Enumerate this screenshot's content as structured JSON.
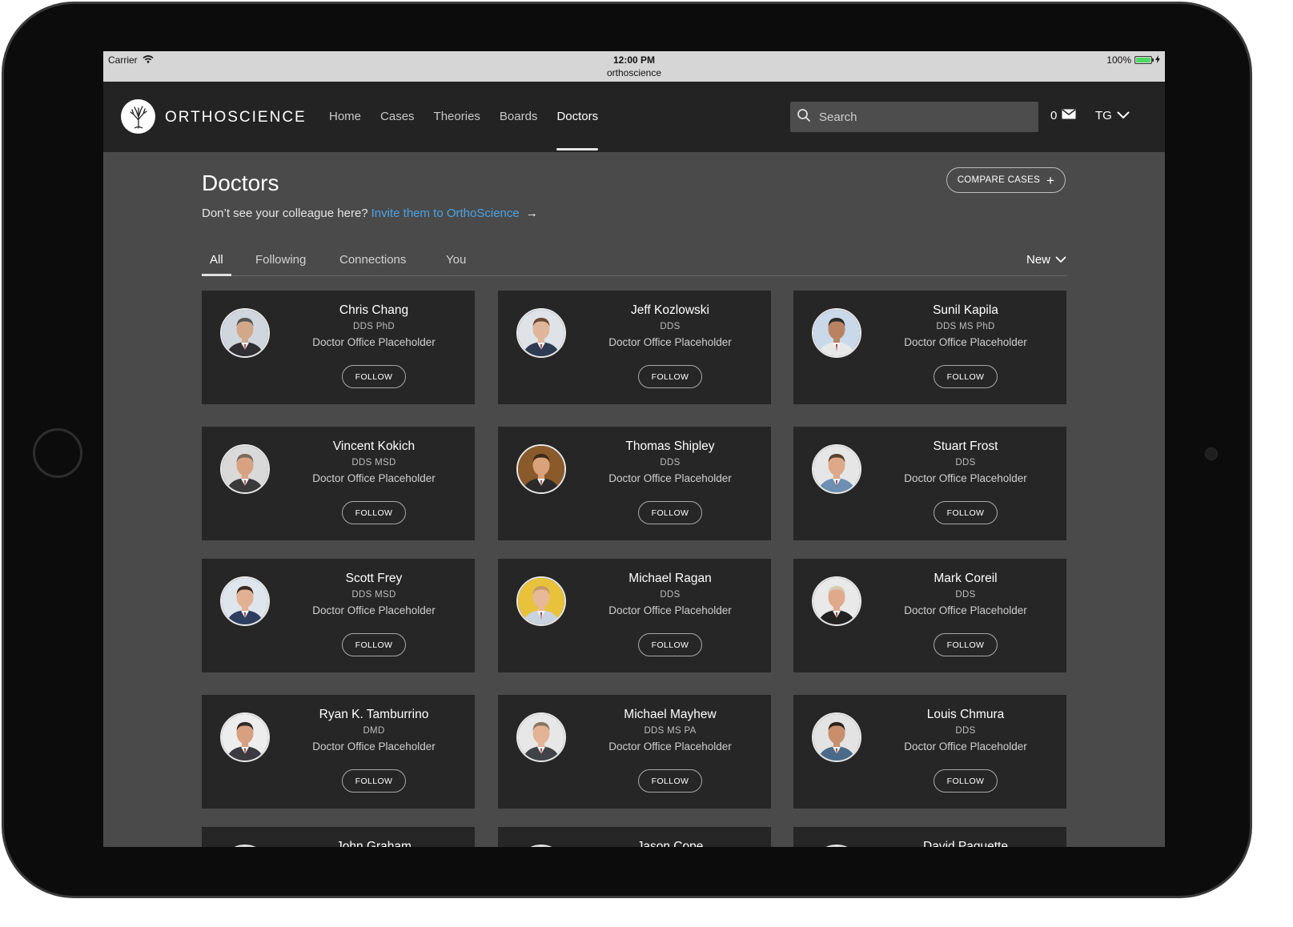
{
  "statusbar": {
    "carrier": "Carrier",
    "time": "12:00 PM",
    "site": "orthoscience",
    "battery": "100%"
  },
  "nav": {
    "logo_text": "ORTHOSCIENCE",
    "links": [
      "Home",
      "Cases",
      "Theories",
      "Boards",
      "Doctors"
    ],
    "active": "Doctors",
    "search_placeholder": "Search",
    "message_count": "0",
    "user_initials": "TG"
  },
  "page": {
    "title": "Doctors",
    "invite_prefix": "Don’t see your colleague here?",
    "invite_link": "Invite them to OrthoScience",
    "invite_arrow": "→",
    "compare_label": "COMPARE CASES",
    "compare_icon": "+"
  },
  "tabs": {
    "items": [
      "All",
      "Following",
      "Connections",
      "You"
    ],
    "active": "All",
    "sort_label": "New"
  },
  "follow_label": "FOLLOW",
  "doctors": [
    {
      "name": "Chris Chang",
      "degree": "DDS PhD",
      "office": "Doctor Office Placeholder",
      "photo_bg": "#cfd6de",
      "skin": "#d2a88a",
      "hair": "#555555",
      "suit": "#2f2f34"
    },
    {
      "name": "Jeff Kozlowski",
      "degree": "DDS",
      "office": "Doctor Office Placeholder",
      "photo_bg": "#dfe3e8",
      "skin": "#e0b69a",
      "hair": "#6b4a33",
      "suit": "#2c3a52"
    },
    {
      "name": "Sunil Kapila",
      "degree": "DDS MS PhD",
      "office": "Doctor Office Placeholder",
      "photo_bg": "#c9d9ea",
      "skin": "#b98362",
      "hair": "#2b2b2b",
      "suit": "#e8e8e8"
    },
    {
      "name": "Vincent Kokich",
      "degree": "DDS MSD",
      "office": "Doctor Office Placeholder",
      "photo_bg": "#d9d9d9",
      "skin": "#d7a282",
      "hair": "#7a6a5e",
      "suit": "#3a3a3a"
    },
    {
      "name": "Thomas Shipley",
      "degree": "DDS",
      "office": "Doctor Office Placeholder",
      "photo_bg": "#8a5a2a",
      "skin": "#d9a27a",
      "hair": "#3b2a1c",
      "suit": "#2a2a2a"
    },
    {
      "name": "Stuart Frost",
      "degree": "DDS",
      "office": "Doctor Office Placeholder",
      "photo_bg": "#e6e6e6",
      "skin": "#dda988",
      "hair": "#5a4030",
      "suit": "#6c8fb3"
    },
    {
      "name": "Scott Frey",
      "degree": "DDS MSD",
      "office": "Doctor Office Placeholder",
      "photo_bg": "#dfe5ec",
      "skin": "#e2b093",
      "hair": "#3a2a20",
      "suit": "#2d3e60"
    },
    {
      "name": "Michael Ragan",
      "degree": "DDS",
      "office": "Doctor Office Placeholder",
      "photo_bg": "#e8c23a",
      "skin": "#e8b899",
      "hair": "#c49a6c",
      "suit": "#c8d2e0"
    },
    {
      "name": "Mark Coreil",
      "degree": "DDS",
      "office": "Doctor Office Placeholder",
      "photo_bg": "#e9e9e9",
      "skin": "#e0a98c",
      "hair": "#d8c9b0",
      "suit": "#222222"
    },
    {
      "name": "Ryan K. Tamburrino",
      "degree": "DMD",
      "office": "Doctor Office Placeholder",
      "photo_bg": "#ededed",
      "skin": "#d6a081",
      "hair": "#2f2a27",
      "suit": "#3a3a40"
    },
    {
      "name": "Michael Mayhew",
      "degree": "DDS MS PA",
      "office": "Doctor Office Placeholder",
      "photo_bg": "#e7e7e7",
      "skin": "#e4b396",
      "hair": "#8a7460",
      "suit": "#404348"
    },
    {
      "name": "Louis Chmura",
      "degree": "DDS",
      "office": "Doctor Office Placeholder",
      "photo_bg": "#e3e3e3",
      "skin": "#c98f6d",
      "hair": "#2b211b",
      "suit": "#4a6a8a"
    },
    {
      "name": "John Graham",
      "degree": "",
      "office": "",
      "photo_bg": "#e3e3e3",
      "skin": "#d8a888",
      "hair": "#555555",
      "suit": "#333333"
    },
    {
      "name": "Jason Cope",
      "degree": "",
      "office": "",
      "photo_bg": "#e3e3e3",
      "skin": "#d8a888",
      "hair": "#555555",
      "suit": "#333333"
    },
    {
      "name": "David Paquette",
      "degree": "",
      "office": "",
      "photo_bg": "#e3e3e3",
      "skin": "#d8a888",
      "hair": "#555555",
      "suit": "#333333"
    }
  ]
}
